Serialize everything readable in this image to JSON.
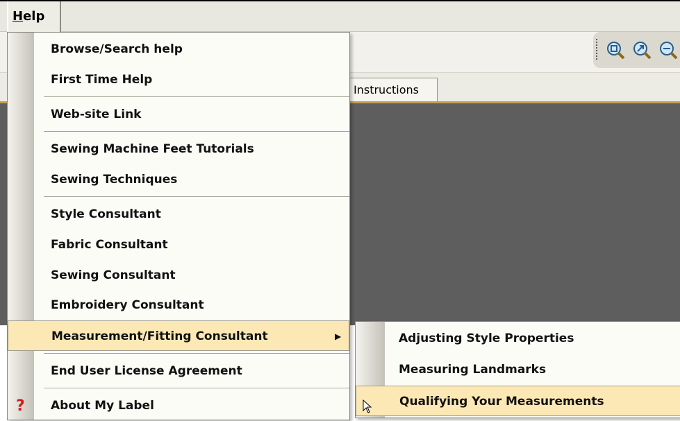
{
  "menubar": {
    "help_mnemonic": "H",
    "help_rest": "elp"
  },
  "tab": {
    "label": "Instructions"
  },
  "toolbar": {
    "icons": [
      "zoom-fit-icon",
      "zoom-in-icon",
      "zoom-out-icon"
    ]
  },
  "help_menu": {
    "items": [
      {
        "label": "Browse/Search help"
      },
      {
        "label": "First Time Help"
      },
      {
        "label": "Web-site Link"
      },
      {
        "label": "Sewing Machine Feet Tutorials"
      },
      {
        "label": "Sewing Techniques"
      },
      {
        "label": "Style Consultant"
      },
      {
        "label": "Fabric Consultant"
      },
      {
        "label": "Sewing Consultant"
      },
      {
        "label": "Embroidery Consultant"
      },
      {
        "label": "Measurement/Fitting Consultant",
        "highlighted": true,
        "submenu_arrow": "▶"
      },
      {
        "label": "End User License Agreement"
      },
      {
        "label": "About My Label",
        "icon": "help-question-icon",
        "icon_glyph": "?"
      }
    ]
  },
  "submenu": {
    "items": [
      {
        "label": "Adjusting Style Properties"
      },
      {
        "label": "Measuring Landmarks"
      },
      {
        "label": "Qualifying Your Measurements",
        "highlighted": true
      }
    ]
  },
  "colors": {
    "menu_highlight": "#fbe8b4",
    "canvas": "#5e5e5e",
    "tab_underline": "#c79e54",
    "help_icon": "#d41c1c"
  }
}
